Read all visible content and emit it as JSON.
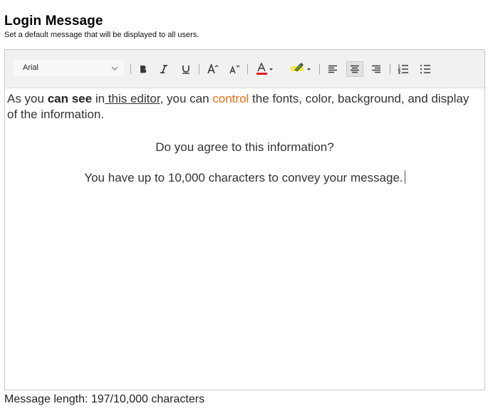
{
  "header": {
    "title": "Login Message",
    "subtitle": "Set a default message that will be displayed to all users."
  },
  "toolbar": {
    "font_family_value": "Arial",
    "buttons": [
      {
        "name": "bold-button",
        "label": "B",
        "icon": "bold-icon"
      },
      {
        "name": "italic-button",
        "label": "I",
        "icon": "italic-icon"
      },
      {
        "name": "underline-button",
        "label": "U",
        "icon": "underline-icon"
      },
      {
        "name": "increase-font-size-button",
        "icon": "font-size-increase-icon"
      },
      {
        "name": "decrease-font-size-button",
        "icon": "font-size-decrease-icon"
      },
      {
        "name": "text-color-button",
        "icon": "text-color-icon",
        "color": "#e01e1e"
      },
      {
        "name": "highlight-color-button",
        "icon": "highlighter-icon",
        "color": "#f6e74d"
      },
      {
        "name": "align-left-button",
        "icon": "align-left-icon"
      },
      {
        "name": "align-center-button",
        "icon": "align-center-icon",
        "active": true
      },
      {
        "name": "align-right-button",
        "icon": "align-right-icon"
      },
      {
        "name": "ordered-list-button",
        "icon": "ordered-list-icon"
      },
      {
        "name": "unordered-list-button",
        "icon": "unordered-list-icon"
      }
    ]
  },
  "content": {
    "p1": {
      "seg1": "As you ",
      "bold": "can see",
      "seg2": " in",
      "link": " this editor",
      "seg3": ", you can ",
      "orange": "control",
      "seg4": " the fonts, color, background, and display of the information.",
      "orange_color": "#f26b0f"
    },
    "p2": "Do you agree to this information?",
    "p3": "You have up to 10,000 characters to convey your message."
  },
  "status": {
    "message_length": "Message length: 197/10,000 characters"
  }
}
